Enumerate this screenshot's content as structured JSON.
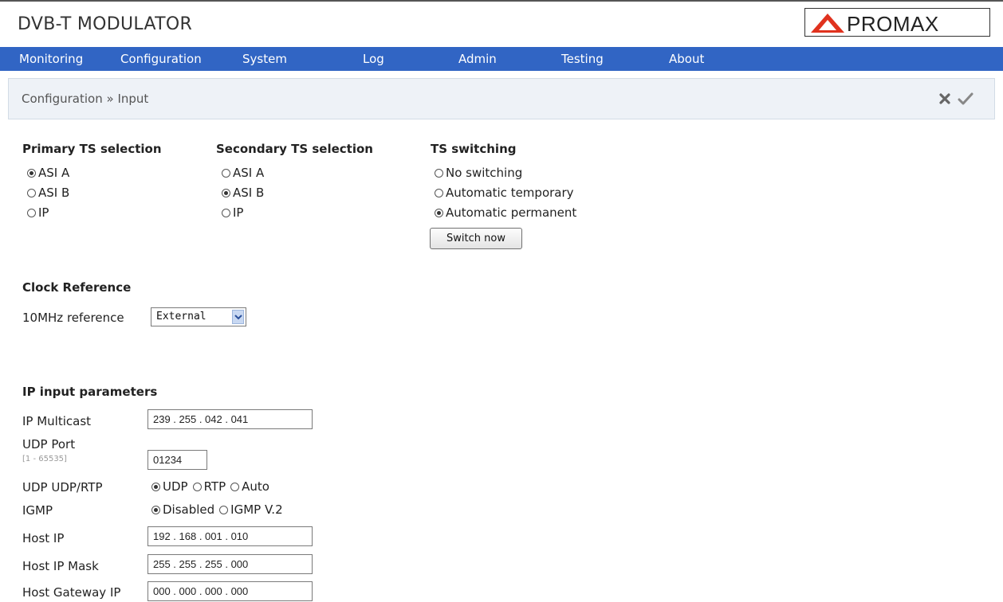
{
  "app": {
    "title": "DVB-T MODULATOR",
    "logo_text": "PROMAX"
  },
  "colors": {
    "nav_bg": "#3165c4",
    "logo_red": "#e0321e",
    "breadcrumb_bg": "#eef2f7"
  },
  "nav": {
    "items": [
      "Monitoring",
      "Configuration",
      "System",
      "Log",
      "Admin",
      "Testing",
      "About"
    ]
  },
  "breadcrumb": "Configuration » Input",
  "icons": {
    "cancel": "close-icon",
    "apply": "checkmark-icon"
  },
  "primary_ts": {
    "title": "Primary TS selection",
    "options": [
      "ASI A",
      "ASI B",
      "IP"
    ],
    "selected": "ASI A"
  },
  "secondary_ts": {
    "title": "Secondary TS selection",
    "options": [
      "ASI A",
      "ASI B",
      "IP"
    ],
    "selected": "ASI B"
  },
  "ts_switching": {
    "title": "TS switching",
    "options": [
      "No switching",
      "Automatic temporary",
      "Automatic permanent"
    ],
    "selected": "Automatic permanent",
    "switch_button": "Switch now"
  },
  "clock": {
    "title": "Clock Reference",
    "label": "10MHz reference",
    "value": "External"
  },
  "ip_input": {
    "title": "IP input parameters",
    "multicast_label": "IP Multicast",
    "multicast_value": "239 . 255 . 042 . 041",
    "udp_port_label": "UDP Port",
    "udp_port_hint": "[1 - 65535]",
    "udp_port_value": "01234",
    "udp_rtp_label": "UDP UDP/RTP",
    "udp_rtp_options": [
      "UDP",
      "RTP",
      "Auto"
    ],
    "udp_rtp_selected": "UDP",
    "igmp_label": "IGMP",
    "igmp_options": [
      "Disabled",
      "IGMP V.2"
    ],
    "igmp_selected": "Disabled",
    "host_ip_label": "Host IP",
    "host_ip_value": "192 . 168 . 001 . 010",
    "host_mask_label": "Host IP Mask",
    "host_mask_value": "255 . 255 . 255 . 000",
    "gateway_label": "Host Gateway IP",
    "gateway_value": "000 . 000 . 000 . 000"
  }
}
